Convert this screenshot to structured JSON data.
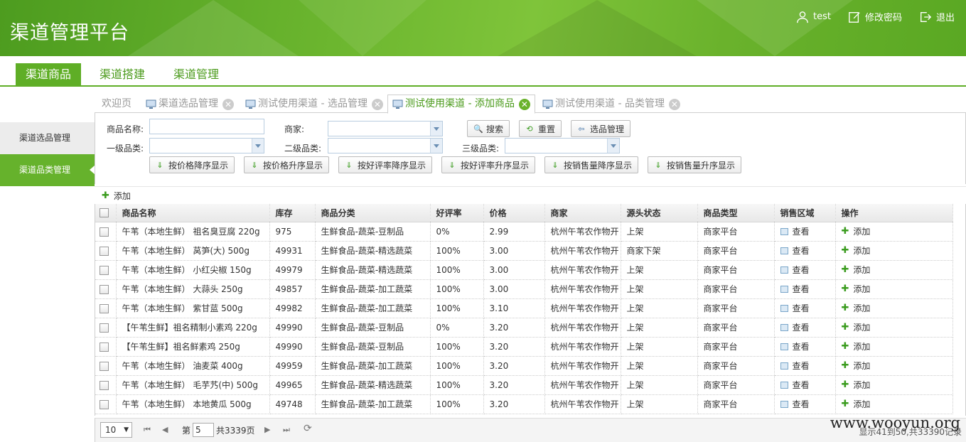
{
  "header": {
    "title": "渠道管理平台",
    "user": "test",
    "change_password": "修改密码",
    "logout": "退出"
  },
  "nav": [
    "渠道商品",
    "渠道搭建",
    "渠道管理"
  ],
  "sidebar": [
    "渠道选品管理",
    "渠道品类管理"
  ],
  "tabs": [
    "欢迎页",
    "渠道选品管理",
    "测试使用渠道 - 选品管理",
    "测试使用渠道 - 添加商品",
    "测试使用渠道 - 品类管理"
  ],
  "filters": {
    "product_name_label": "商品名称:",
    "merchant_label": "商家:",
    "cat1_label": "一级品类:",
    "cat2_label": "二级品类:",
    "cat3_label": "三级品类:",
    "search_btn": "搜索",
    "reset_btn": "重置",
    "select_mgmt_btn": "选品管理",
    "sort_buttons": [
      "按价格降序显示",
      "按价格升序显示",
      "按好评率降序显示",
      "按好评率升序显示",
      "按销售量降序显示",
      "按销售量升序显示"
    ]
  },
  "toolbar": {
    "add": "添加"
  },
  "table": {
    "columns": [
      "商品名称",
      "库存",
      "商品分类",
      "好评率",
      "价格",
      "商家",
      "源头状态",
      "商品类型",
      "销售区域",
      "操作"
    ],
    "view_label": "查看",
    "add_label": "添加",
    "rows": [
      [
        "午苇（本地生鲜） 祖名臭豆腐 220g",
        "975",
        "生鲜食品-蔬菜-豆制品",
        "0%",
        "2.99",
        "杭州午苇农作物开",
        "上架",
        "商家平台"
      ],
      [
        "午苇（本地生鲜） 莴笋(大) 500g",
        "49931",
        "生鲜食品-蔬菜-精选蔬菜",
        "100%",
        "3.00",
        "杭州午苇农作物开",
        "商家下架",
        "商家平台"
      ],
      [
        "午苇（本地生鲜） 小红尖椒 150g",
        "49979",
        "生鲜食品-蔬菜-精选蔬菜",
        "100%",
        "3.00",
        "杭州午苇农作物开",
        "上架",
        "商家平台"
      ],
      [
        "午苇（本地生鲜） 大蒜头 250g",
        "49857",
        "生鲜食品-蔬菜-加工蔬菜",
        "100%",
        "3.00",
        "杭州午苇农作物开",
        "上架",
        "商家平台"
      ],
      [
        "午苇（本地生鲜） 紫甘蓝 500g",
        "49982",
        "生鲜食品-蔬菜-加工蔬菜",
        "100%",
        "3.10",
        "杭州午苇农作物开",
        "上架",
        "商家平台"
      ],
      [
        "【午苇生鲜】祖名精制小素鸡 220g",
        "49990",
        "生鲜食品-蔬菜-豆制品",
        "0%",
        "3.20",
        "杭州午苇农作物开",
        "上架",
        "商家平台"
      ],
      [
        "【午苇生鲜】祖名鲜素鸡 250g",
        "49990",
        "生鲜食品-蔬菜-豆制品",
        "100%",
        "3.20",
        "杭州午苇农作物开",
        "上架",
        "商家平台"
      ],
      [
        "午苇（本地生鲜） 油麦菜 400g",
        "49959",
        "生鲜食品-蔬菜-加工蔬菜",
        "100%",
        "3.20",
        "杭州午苇农作物开",
        "上架",
        "商家平台"
      ],
      [
        "午苇（本地生鲜） 毛芋艿(中) 500g",
        "49965",
        "生鲜食品-蔬菜-精选蔬菜",
        "100%",
        "3.20",
        "杭州午苇农作物开",
        "上架",
        "商家平台"
      ],
      [
        "午苇（本地生鲜） 本地黄瓜 500g",
        "49748",
        "生鲜食品-蔬菜-加工蔬菜",
        "100%",
        "3.20",
        "杭州午苇农作物开",
        "上架",
        "商家平台"
      ]
    ]
  },
  "pager": {
    "page_size": "10",
    "page_prefix": "第",
    "page_value": "5",
    "page_total": "共3339页",
    "summary": "显示41到50,共33390记录"
  },
  "watermark": "www.wooyun.org"
}
